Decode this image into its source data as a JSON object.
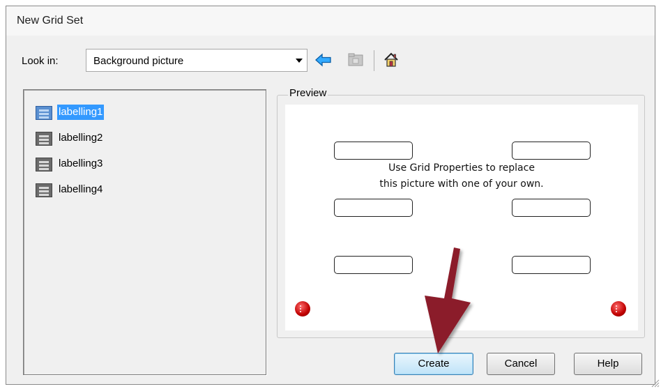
{
  "window": {
    "title": "New Grid Set"
  },
  "lookin": {
    "label": "Look in:",
    "value": "Background picture"
  },
  "toolbar": {
    "back_icon": "back-arrow-icon",
    "folder_icon": "folder-up-icon",
    "home_icon": "home-icon"
  },
  "list": {
    "items": [
      {
        "label": "labelling1",
        "selected": true
      },
      {
        "label": "labelling2",
        "selected": false
      },
      {
        "label": "labelling3",
        "selected": false
      },
      {
        "label": "labelling4",
        "selected": false
      }
    ]
  },
  "preview": {
    "legend": "Preview",
    "line1": "Use Grid Properties to replace",
    "line2": "this picture with one of your own."
  },
  "buttons": {
    "create": "Create",
    "cancel": "Cancel",
    "help": "Help"
  },
  "colors": {
    "selection": "#3399ff",
    "annotation_arrow": "#8b1a2a",
    "nav_button": "#c00000"
  }
}
